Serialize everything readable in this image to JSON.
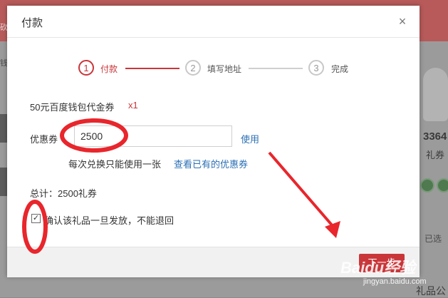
{
  "background": {
    "bar_text": "砍",
    "left_text": "钱",
    "right_number": "3364",
    "right_label": "礼券",
    "right_status": "已选",
    "right_bottom": "礼品公"
  },
  "dialog": {
    "title": "付款",
    "close_label": "×",
    "steps": [
      {
        "num": "1",
        "label": "付款",
        "state": "active"
      },
      {
        "num": "2",
        "label": "填写地址",
        "state": "todo"
      },
      {
        "num": "3",
        "label": "完成",
        "state": "todo"
      }
    ],
    "coupon_name": "50元百度钱包代金券",
    "coupon_qty": "x1",
    "voucher_label": "优惠券",
    "voucher_value": "2500",
    "use_link": "使用",
    "rule_text": "每次兑换只能使用一张",
    "view_link": "查看已有的优惠券",
    "total_text": "总计：2500礼券",
    "confirm_text": "确认该礼品一旦发放，不能退回",
    "confirm_checked": true,
    "next_label": "下一步"
  },
  "watermark": {
    "brand": "Baidu经验",
    "url": "jingyan.baidu.com"
  },
  "colors": {
    "accent": "#c9363a",
    "link": "#2a6fb5",
    "annotation": "#e8262c"
  }
}
